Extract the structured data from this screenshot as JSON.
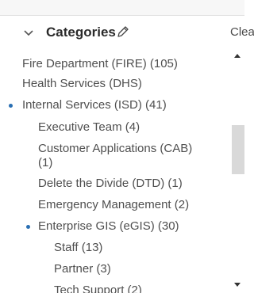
{
  "header": {
    "title": "Categories",
    "clear_label": "Clear"
  },
  "list": {
    "clipped_text": "Fire Department (FIRE) (105)",
    "items": [
      "Fire Department (FIRE) (105)",
      "Health Services (DHS)",
      "Internal Services (ISD) (41)",
      "Executive Team (4)",
      "Customer Applications (CAB) (1)",
      "Delete the Divide (DTD) (1)",
      "Emergency Management (2)",
      "Enterprise GIS (eGIS) (30)",
      "Staff (13)",
      "Partner (3)",
      "Tech Support (2)"
    ]
  },
  "colors": {
    "bullet": "#2a6fb3",
    "topbar": "#f7f7f7"
  },
  "icons": {
    "collapse": "chevron-down-icon",
    "edit": "pencil-icon",
    "scroll_up": "triangle-up-icon",
    "scroll_down": "triangle-down-icon"
  }
}
